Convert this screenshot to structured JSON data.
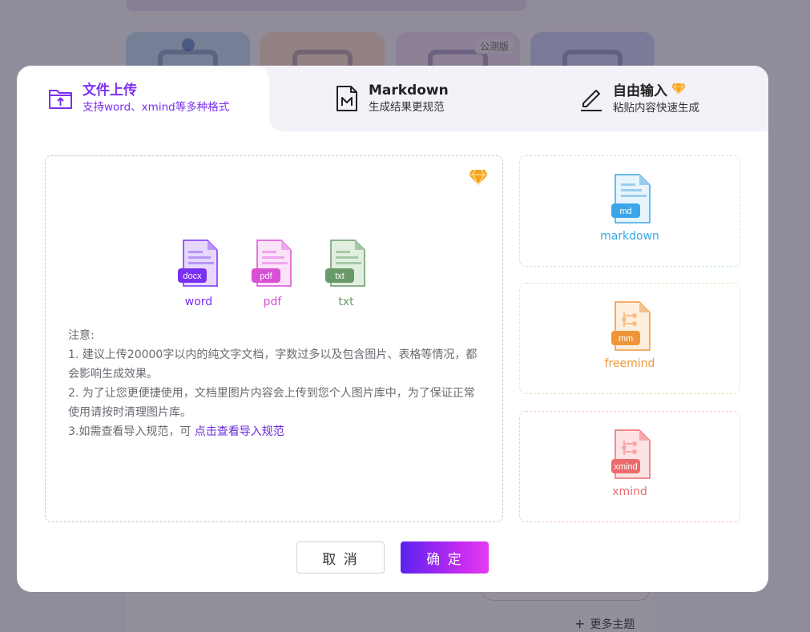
{
  "background": {
    "badge": "公测版",
    "more_themes": "更多主题"
  },
  "tabs": [
    {
      "title": "文件上传",
      "subtitle": "支持word、xmind等多种格式"
    },
    {
      "title": "Markdown",
      "subtitle": "生成结果更规范"
    },
    {
      "title": "自由输入",
      "subtitle": "粘贴内容快速生成"
    }
  ],
  "file_types": [
    {
      "badge": "docx",
      "label": "word",
      "color": "#7b2ff2"
    },
    {
      "badge": "pdf",
      "label": "pdf",
      "color": "#d94fd6"
    },
    {
      "badge": "txt",
      "label": "txt",
      "color": "#6a9a6a"
    }
  ],
  "notes": {
    "heading": "注意:",
    "line1": "1. 建议上传20000字以内的纯文字文档，字数过多以及包含图片、表格等情况，都会影响生成效果。",
    "line2": "2. 为了让您更便捷使用，文档里图片内容会上传到您个人图片库中，为了保证正常使用请按时清理图片库。",
    "line3_prefix": "3.如需查看导入规范，可",
    "line3_link": "点击查看导入规范"
  },
  "options": [
    {
      "badge": "md",
      "label": "markdown",
      "color": "#3aa6e8"
    },
    {
      "badge": "mm",
      "label": "freemind",
      "color": "#f0963a"
    },
    {
      "badge": "xmind",
      "label": "xmind",
      "color": "#ec6b6e"
    }
  ],
  "buttons": {
    "cancel": "取 消",
    "confirm": "确 定"
  },
  "colors": {
    "accent": "#7b2ff2",
    "vip": "#f6a21a"
  }
}
